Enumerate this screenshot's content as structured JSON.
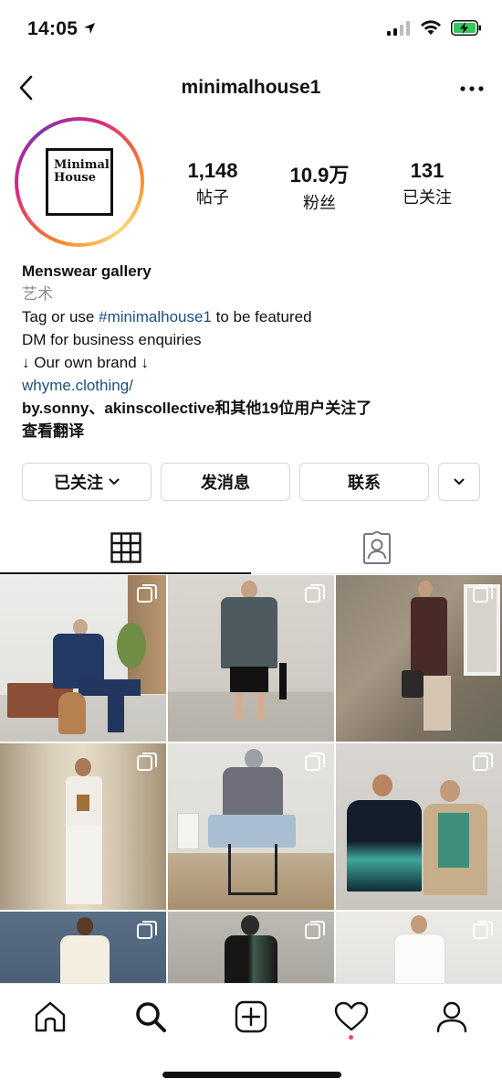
{
  "status_bar": {
    "time": "14:05"
  },
  "header": {
    "username": "minimalhouse1"
  },
  "profile": {
    "logo_text_line1": "Minimal",
    "logo_text_line2": "House",
    "stats": [
      {
        "value": "1,148",
        "label": "帖子"
      },
      {
        "value": "10.9万",
        "label": "粉丝"
      },
      {
        "value": "131",
        "label": "已关注"
      }
    ],
    "name": "Menswear gallery",
    "category": "艺术",
    "bio_line1_before": "Tag or use ",
    "bio_line1_hashtag": "#minimalhouse1",
    "bio_line1_after": " to be featured",
    "bio_line2": "DM for business enquiries",
    "bio_line3": "↓ Our own brand ↓",
    "website": "whyme.clothing/",
    "followed_by": "by.sonny、akinscollective和其他19位用户关注了",
    "translate": "查看翻译"
  },
  "actions": {
    "following": "已关注",
    "message": "发消息",
    "contact": "联系"
  },
  "colors": {
    "link": "#1e4f7c",
    "notification_dot": "#ed4956",
    "battery_green": "#34c759"
  },
  "tabs": [
    {
      "icon": "grid-icon",
      "active": true
    },
    {
      "icon": "tagged-person-icon",
      "active": false
    }
  ],
  "posts": [
    {
      "scene": "man in denim seated on bench with dog",
      "multi": true
    },
    {
      "scene": "man in grey blazer and shorts",
      "multi": true
    },
    {
      "scene": "man in brown coat by stone wall",
      "multi": true
    },
    {
      "scene": "man in white vest and trousers in hallway",
      "multi": true
    },
    {
      "scene": "man in grey sweater taking mirror selfie on chair",
      "multi": true
    },
    {
      "scene": "two men in flame sweater and jacket",
      "multi": true
    },
    {
      "scene": "man in cream sweater against blue wall",
      "multi": true
    },
    {
      "scene": "man in black and green jacket",
      "multi": true
    },
    {
      "scene": "man in white t-shirt",
      "multi": true
    }
  ],
  "bottom_nav": [
    "home-icon",
    "search-icon",
    "add-post-icon",
    "activity-heart-icon",
    "profile-icon"
  ]
}
